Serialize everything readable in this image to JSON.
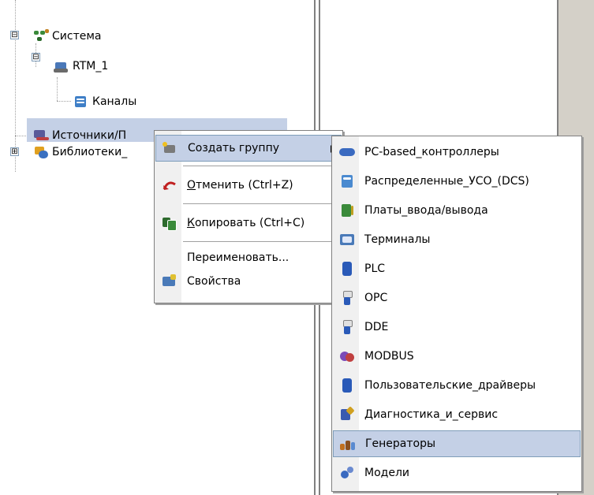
{
  "tree": {
    "nodes": [
      {
        "label": "Система",
        "expander": "⊟"
      },
      {
        "label": "RTM_1",
        "expander": "⊟"
      },
      {
        "label": "Каналы"
      },
      {
        "label": "Источники/П"
      },
      {
        "label": "Библиотеки_",
        "expander": "⊞"
      }
    ]
  },
  "context_menu": {
    "items": [
      {
        "label": "Создать группу"
      },
      {
        "mnemonic": "О",
        "rest": "тменить (Ctrl+Z)"
      },
      {
        "mnemonic": "К",
        "rest": "опировать (Ctrl+C)"
      },
      {
        "label": "Переименовать..."
      },
      {
        "label": "Свойства"
      }
    ]
  },
  "submenu": {
    "items": [
      {
        "label": "PC-based_контроллеры"
      },
      {
        "label": "Распределенные_УСО_(DCS)"
      },
      {
        "label": "Платы_ввода/вывода"
      },
      {
        "label": "Терминалы"
      },
      {
        "label": "PLC"
      },
      {
        "label": "OPC"
      },
      {
        "label": "DDE"
      },
      {
        "label": "MODBUS"
      },
      {
        "label": "Пользовательские_драйверы"
      },
      {
        "label": "Диагностика_и_сервис"
      },
      {
        "label": "Генераторы"
      },
      {
        "label": "Модели"
      }
    ],
    "selected": "Генераторы"
  },
  "colors": {
    "highlight": "#c4d0e6",
    "highlight_border": "#7f9db9",
    "gutter": "#f0f0f0",
    "panel_gray": "#d4d0c8"
  }
}
